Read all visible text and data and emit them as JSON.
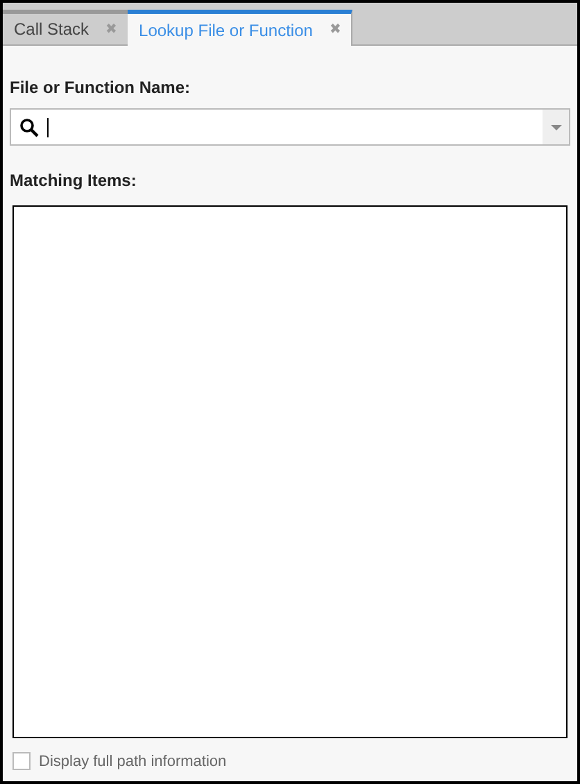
{
  "tabs": [
    {
      "label": "Call Stack",
      "close": "✖",
      "selected": false
    },
    {
      "label": "Lookup File or Function",
      "close": "✖",
      "selected": true
    }
  ],
  "search": {
    "label": "File or Function Name:"
  },
  "matching": {
    "label": "Matching Items:"
  },
  "option": {
    "label": "Display full path information",
    "checked": false
  }
}
